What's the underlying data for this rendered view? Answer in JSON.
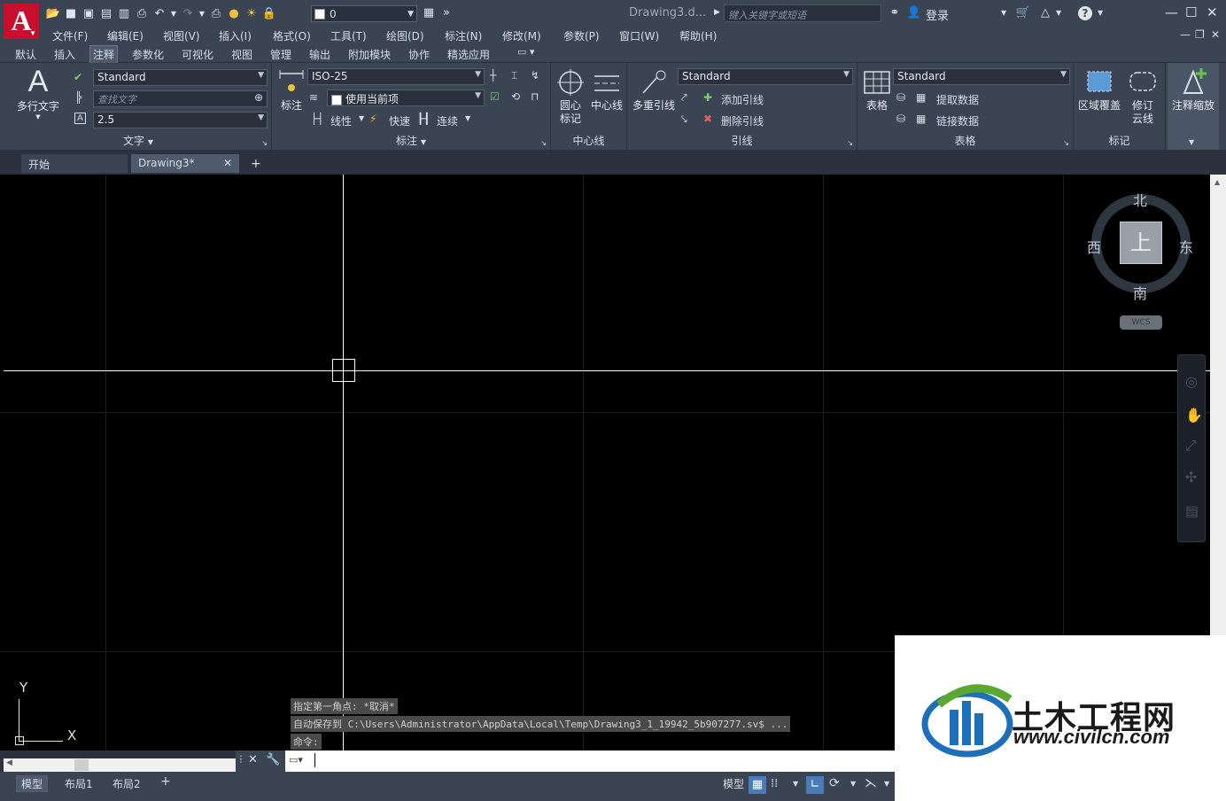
{
  "titlebar": {
    "app_logo": "A",
    "layer_value": "0",
    "document_title": "Drawing3.d...",
    "search_placeholder": "键入关键字或短语",
    "login_label": "登录",
    "help_label": "?"
  },
  "menubar": {
    "items": [
      "文件(F)",
      "编辑(E)",
      "视图(V)",
      "插入(I)",
      "格式(O)",
      "工具(T)",
      "绘图(D)",
      "标注(N)",
      "修改(M)",
      "参数(P)",
      "窗口(W)",
      "帮助(H)"
    ]
  },
  "ribbon_tabs": {
    "items": [
      "默认",
      "插入",
      "注释",
      "参数化",
      "可视化",
      "视图",
      "管理",
      "输出",
      "附加模块",
      "协作",
      "精选应用"
    ],
    "active": "注释"
  },
  "ribbon": {
    "text_panel": {
      "label": "文字",
      "multiline_text": "多行文字",
      "text_style": "Standard",
      "find_text_placeholder": "查找文字",
      "text_height": "2.5"
    },
    "dim_panel": {
      "label": "标注",
      "dimension": "标注",
      "dim_style": "ISO-25",
      "layer_override": "使用当前项",
      "linear": "线性",
      "quick": "快速",
      "continue": "连续"
    },
    "centerline_panel": {
      "label": "中心线",
      "center_mark_line1": "圆心",
      "center_mark_line2": "标记",
      "centerline": "中心线"
    },
    "leader_panel": {
      "label": "引线",
      "multileader": "多重引线",
      "leader_style": "Standard",
      "add_leader": "添加引线",
      "remove_leader": "删除引线"
    },
    "table_panel": {
      "label": "表格",
      "table": "表格",
      "table_style": "Standard",
      "extract_data": "提取数据",
      "link_data": "链接数据"
    },
    "markup_panel": {
      "label": "标记",
      "wipeout": "区域覆盖",
      "revcloud_line1": "修订",
      "revcloud_line2": "云线"
    },
    "annotation_scaling": {
      "label": "注释缩放"
    }
  },
  "document_tabs": {
    "items": [
      "开始",
      "Drawing3*"
    ],
    "active": "Drawing3*"
  },
  "viewcube": {
    "north": "北",
    "south": "南",
    "west": "西",
    "east": "东",
    "top_face": "上",
    "wcs": "WCS"
  },
  "ucs": {
    "y_label": "Y",
    "x_label": "X"
  },
  "command_history": [
    "指定第一角点: *取消*",
    "自动保存到 C:\\Users\\Administrator\\AppData\\Local\\Temp\\Drawing3_1_19942_5b907277.sv$ ...",
    "命令:"
  ],
  "command_input": {
    "value": ""
  },
  "layout_tabs": {
    "items": [
      "模型",
      "布局1",
      "布局2"
    ],
    "active": "模型"
  },
  "status_bar": {
    "model_label": "模型"
  },
  "watermark": {
    "cn_text": "土木工程网",
    "url_text": "www.civilcn.com"
  },
  "colors": {
    "chrome": "#3b4453",
    "canvas": "#000000",
    "crosshair": "#ffffff",
    "logo_red": "#c8102e",
    "watermark_blue": "#1c6fb8",
    "watermark_green": "#5aa832"
  }
}
